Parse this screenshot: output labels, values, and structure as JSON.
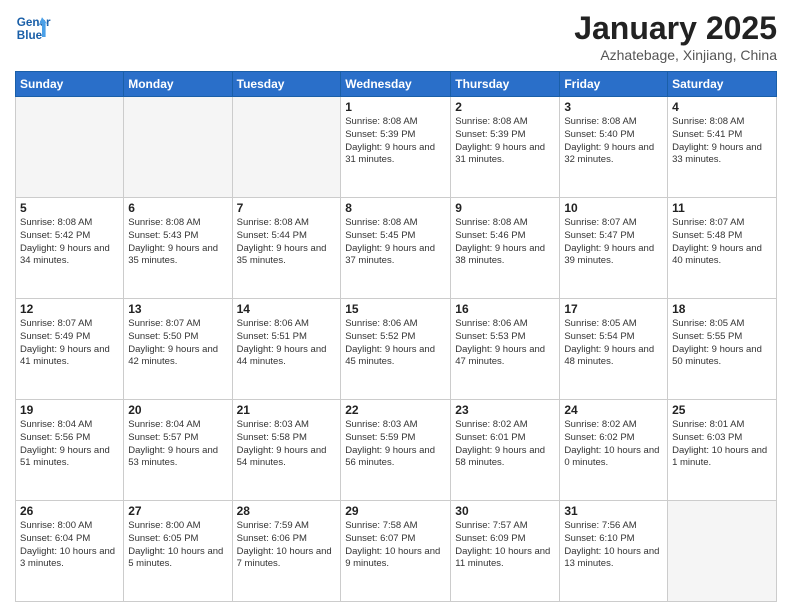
{
  "header": {
    "logo_line1": "General",
    "logo_line2": "Blue",
    "title": "January 2025",
    "subtitle": "Azhatebage, Xinjiang, China"
  },
  "weekdays": [
    "Sunday",
    "Monday",
    "Tuesday",
    "Wednesday",
    "Thursday",
    "Friday",
    "Saturday"
  ],
  "weeks": [
    [
      {
        "day": "",
        "info": ""
      },
      {
        "day": "",
        "info": ""
      },
      {
        "day": "",
        "info": ""
      },
      {
        "day": "1",
        "info": "Sunrise: 8:08 AM\nSunset: 5:39 PM\nDaylight: 9 hours and 31 minutes."
      },
      {
        "day": "2",
        "info": "Sunrise: 8:08 AM\nSunset: 5:39 PM\nDaylight: 9 hours and 31 minutes."
      },
      {
        "day": "3",
        "info": "Sunrise: 8:08 AM\nSunset: 5:40 PM\nDaylight: 9 hours and 32 minutes."
      },
      {
        "day": "4",
        "info": "Sunrise: 8:08 AM\nSunset: 5:41 PM\nDaylight: 9 hours and 33 minutes."
      }
    ],
    [
      {
        "day": "5",
        "info": "Sunrise: 8:08 AM\nSunset: 5:42 PM\nDaylight: 9 hours and 34 minutes."
      },
      {
        "day": "6",
        "info": "Sunrise: 8:08 AM\nSunset: 5:43 PM\nDaylight: 9 hours and 35 minutes."
      },
      {
        "day": "7",
        "info": "Sunrise: 8:08 AM\nSunset: 5:44 PM\nDaylight: 9 hours and 35 minutes."
      },
      {
        "day": "8",
        "info": "Sunrise: 8:08 AM\nSunset: 5:45 PM\nDaylight: 9 hours and 37 minutes."
      },
      {
        "day": "9",
        "info": "Sunrise: 8:08 AM\nSunset: 5:46 PM\nDaylight: 9 hours and 38 minutes."
      },
      {
        "day": "10",
        "info": "Sunrise: 8:07 AM\nSunset: 5:47 PM\nDaylight: 9 hours and 39 minutes."
      },
      {
        "day": "11",
        "info": "Sunrise: 8:07 AM\nSunset: 5:48 PM\nDaylight: 9 hours and 40 minutes."
      }
    ],
    [
      {
        "day": "12",
        "info": "Sunrise: 8:07 AM\nSunset: 5:49 PM\nDaylight: 9 hours and 41 minutes."
      },
      {
        "day": "13",
        "info": "Sunrise: 8:07 AM\nSunset: 5:50 PM\nDaylight: 9 hours and 42 minutes."
      },
      {
        "day": "14",
        "info": "Sunrise: 8:06 AM\nSunset: 5:51 PM\nDaylight: 9 hours and 44 minutes."
      },
      {
        "day": "15",
        "info": "Sunrise: 8:06 AM\nSunset: 5:52 PM\nDaylight: 9 hours and 45 minutes."
      },
      {
        "day": "16",
        "info": "Sunrise: 8:06 AM\nSunset: 5:53 PM\nDaylight: 9 hours and 47 minutes."
      },
      {
        "day": "17",
        "info": "Sunrise: 8:05 AM\nSunset: 5:54 PM\nDaylight: 9 hours and 48 minutes."
      },
      {
        "day": "18",
        "info": "Sunrise: 8:05 AM\nSunset: 5:55 PM\nDaylight: 9 hours and 50 minutes."
      }
    ],
    [
      {
        "day": "19",
        "info": "Sunrise: 8:04 AM\nSunset: 5:56 PM\nDaylight: 9 hours and 51 minutes."
      },
      {
        "day": "20",
        "info": "Sunrise: 8:04 AM\nSunset: 5:57 PM\nDaylight: 9 hours and 53 minutes."
      },
      {
        "day": "21",
        "info": "Sunrise: 8:03 AM\nSunset: 5:58 PM\nDaylight: 9 hours and 54 minutes."
      },
      {
        "day": "22",
        "info": "Sunrise: 8:03 AM\nSunset: 5:59 PM\nDaylight: 9 hours and 56 minutes."
      },
      {
        "day": "23",
        "info": "Sunrise: 8:02 AM\nSunset: 6:01 PM\nDaylight: 9 hours and 58 minutes."
      },
      {
        "day": "24",
        "info": "Sunrise: 8:02 AM\nSunset: 6:02 PM\nDaylight: 10 hours and 0 minutes."
      },
      {
        "day": "25",
        "info": "Sunrise: 8:01 AM\nSunset: 6:03 PM\nDaylight: 10 hours and 1 minute."
      }
    ],
    [
      {
        "day": "26",
        "info": "Sunrise: 8:00 AM\nSunset: 6:04 PM\nDaylight: 10 hours and 3 minutes."
      },
      {
        "day": "27",
        "info": "Sunrise: 8:00 AM\nSunset: 6:05 PM\nDaylight: 10 hours and 5 minutes."
      },
      {
        "day": "28",
        "info": "Sunrise: 7:59 AM\nSunset: 6:06 PM\nDaylight: 10 hours and 7 minutes."
      },
      {
        "day": "29",
        "info": "Sunrise: 7:58 AM\nSunset: 6:07 PM\nDaylight: 10 hours and 9 minutes."
      },
      {
        "day": "30",
        "info": "Sunrise: 7:57 AM\nSunset: 6:09 PM\nDaylight: 10 hours and 11 minutes."
      },
      {
        "day": "31",
        "info": "Sunrise: 7:56 AM\nSunset: 6:10 PM\nDaylight: 10 hours and 13 minutes."
      },
      {
        "day": "",
        "info": ""
      }
    ]
  ]
}
